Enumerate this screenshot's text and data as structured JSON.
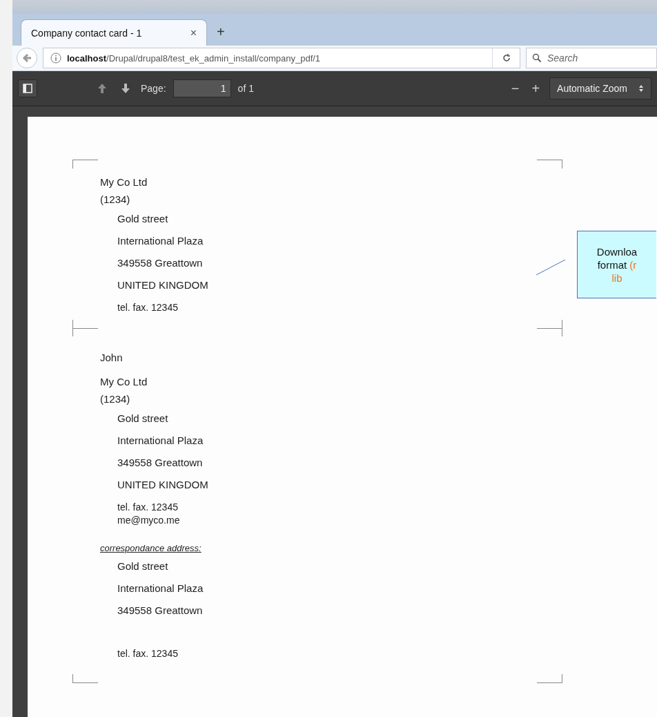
{
  "tab": {
    "title": "Company contact card - 1",
    "close": "×",
    "selected": true
  },
  "new_tab": "+",
  "address_bar": {
    "host": "localhost",
    "path": "/Drupal/drupal8/test_ek_admin_install/company_pdf/1"
  },
  "search": {
    "placeholder": "Search"
  },
  "pdf_toolbar": {
    "page_label": "Page:",
    "page_value": "1",
    "page_count": "of 1",
    "zoom_out": "−",
    "zoom_in": "+",
    "zoom": "Automatic Zoom"
  },
  "document": {
    "sections": [
      {
        "lines": [
          {
            "kind": "heading",
            "text": "My Co Ltd"
          },
          {
            "kind": "heading",
            "text": "(1234)"
          },
          {
            "kind": "address",
            "text": "Gold street"
          },
          {
            "kind": "address",
            "text": "International Plaza"
          },
          {
            "kind": "address",
            "text": "349558 Greattown"
          },
          {
            "kind": "address",
            "text": "UNITED KINGDOM"
          },
          {
            "kind": "contact",
            "text": "tel.  fax. 12345"
          }
        ]
      },
      {
        "lines": [
          {
            "kind": "person",
            "text": "John"
          },
          {
            "kind": "heading",
            "text": "My Co Ltd"
          },
          {
            "kind": "heading",
            "text": "(1234)"
          },
          {
            "kind": "address",
            "text": "Gold street"
          },
          {
            "kind": "address",
            "text": "International Plaza"
          },
          {
            "kind": "address",
            "text": "349558 Greattown"
          },
          {
            "kind": "address",
            "text": "UNITED KINGDOM"
          },
          {
            "kind": "contact",
            "text": "tel.  fax. 12345"
          },
          {
            "kind": "email",
            "text": "me@myco.me"
          },
          {
            "kind": "note",
            "text": "correspondance address:"
          },
          {
            "kind": "address",
            "text": "Gold street"
          },
          {
            "kind": "address",
            "text": "International Plaza"
          },
          {
            "kind": "address",
            "text": "349558 Greattown"
          },
          {
            "kind": "contact_far",
            "text": "tel.  fax. 12345"
          }
        ]
      }
    ]
  },
  "callout": {
    "lines": [
      "Downloa",
      "format ",
      "(r",
      "lib"
    ]
  }
}
